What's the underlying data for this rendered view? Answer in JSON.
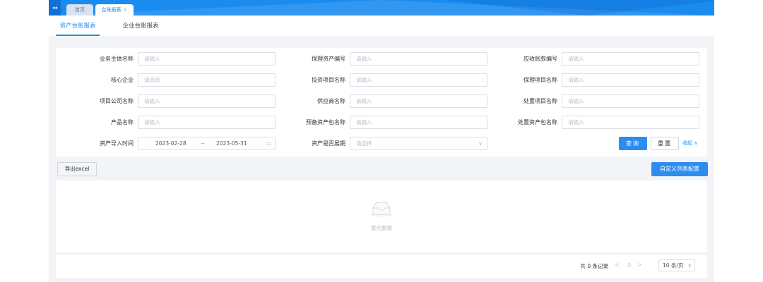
{
  "tabs": [
    {
      "label": "首页"
    },
    {
      "label": "台账报表",
      "close": "×"
    }
  ],
  "icons": {
    "collapse": "double-left-arrow-icon",
    "close": "close-icon",
    "calendar": "calendar-icon",
    "empty": "empty-box-icon",
    "select": "chevron-down-icon"
  },
  "collapse_glyph": "◂◂",
  "subtabs": [
    "资产台账报表",
    "企业台账报表"
  ],
  "form": {
    "rows": [
      [
        {
          "label": "业务主体名称",
          "placeholder": "请输入"
        },
        {
          "label": "保理资产编号",
          "placeholder": "请输入"
        },
        {
          "label": "应收账款编号",
          "placeholder": "请输入"
        }
      ],
      [
        {
          "label": "核心企业",
          "placeholder": "请选择"
        },
        {
          "label": "投资项目名称",
          "placeholder": "请输入"
        },
        {
          "label": "保理项目名称",
          "placeholder": "请输入"
        }
      ],
      [
        {
          "label": "项目公司名称",
          "placeholder": "请输入"
        },
        {
          "label": "供应商名称",
          "placeholder": "请输入"
        },
        {
          "label": "处置项目名称",
          "placeholder": "请输入"
        }
      ],
      [
        {
          "label": "产品名称",
          "placeholder": "请输入"
        },
        {
          "label": "预备资产包名称",
          "placeholder": "请输入"
        },
        {
          "label": "处置资产包名称",
          "placeholder": "请输入"
        }
      ]
    ],
    "import_time": {
      "label": "资产导入时间",
      "start": "2023-02-28",
      "separator": "~",
      "end": "2023-05-31"
    },
    "extended": {
      "label": "资产是否展期",
      "placeholder": "请选择"
    },
    "query_label": "查询",
    "reset_label": "重置",
    "collapse_label": "收起 ∧"
  },
  "toolbar": {
    "export_label": "导出excel",
    "config_label": "自定义列表配置"
  },
  "table": {
    "empty_text": "暂无数据"
  },
  "pagination": {
    "total": "共 0 条记录",
    "prev": "<",
    "current": "0",
    "next": ">",
    "page_size": "10 条/页",
    "size_arrow": "∨"
  },
  "colors": {
    "primary": "#1a8cf0",
    "button": "#2d8cf0",
    "background": "#f2f4f7"
  }
}
